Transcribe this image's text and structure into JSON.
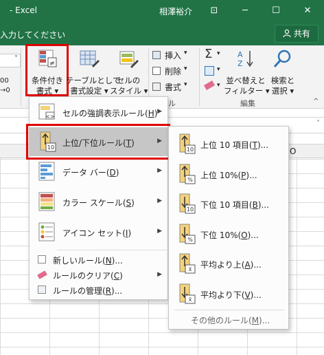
{
  "titlebar": {
    "app": "- Excel",
    "user": "相澤裕介",
    "restore_glyph": "⊡",
    "min_glyph": "─",
    "max_glyph": "☐",
    "close_glyph": "✕"
  },
  "tellme": {
    "text": "入力してください",
    "share_label": "共有",
    "share_icon": "person-icon"
  },
  "ribbon": {
    "font_box_chevron": "˅",
    "cf_button": {
      "line1": "条件付き",
      "line2": "書式 ▾"
    },
    "table_button": {
      "line1": "テーブルとして",
      "line2": "書式設定 ▾"
    },
    "style_button": {
      "line1": "セルの",
      "line2": "スタイル ▾"
    },
    "insert": "挿入",
    "delete": "削除",
    "format": "書式",
    "sort": {
      "line1": "並べ替えと",
      "line2": "フィルター ▾"
    },
    "find": {
      "line1": "検索と",
      "line2": "選択 ▾"
    },
    "group_cells": "セル",
    "group_edit": "編集",
    "num_fmt_left": "00",
    "num_fmt_right": "→0"
  },
  "column_label": "O",
  "cf_menu": {
    "items": [
      {
        "label": "セルの強調表示ルール(",
        "key": "H",
        "tail": ")"
      },
      {
        "label": "上位/下位ルール(",
        "key": "T",
        "tail": ")"
      },
      {
        "label": "データ バー(",
        "key": "D",
        "tail": ")"
      },
      {
        "label": "カラー スケール(",
        "key": "S",
        "tail": ")"
      },
      {
        "label": "アイコン セット(",
        "key": "I",
        "tail": ")"
      }
    ],
    "small_items": [
      {
        "label": "新しいルール(",
        "key": "N",
        "tail": ")..."
      },
      {
        "label": "ルールのクリア(",
        "key": "C",
        "tail": ")"
      },
      {
        "label": "ルールの管理(",
        "key": "R",
        "tail": ")..."
      }
    ]
  },
  "sub_menu": {
    "items": [
      {
        "label": "上位 10 項目(",
        "key": "T",
        "tail": ")...",
        "badge": "10"
      },
      {
        "label": "上位 10%(",
        "key": "P",
        "tail": ")...",
        "badge": "%"
      },
      {
        "label": "下位 10 項目(",
        "key": "B",
        "tail": ")...",
        "badge": "10"
      },
      {
        "label": "下位 10%(",
        "key": "O",
        "tail": ")...",
        "badge": "%"
      },
      {
        "label": "平均より上(",
        "key": "A",
        "tail": ")...",
        "badge": "x̄"
      },
      {
        "label": "平均より下(",
        "key": "V",
        "tail": ")...",
        "badge": "x̄"
      }
    ],
    "more": {
      "label": "その他のルール(",
      "key": "M",
      "tail": ")..."
    }
  },
  "colors": {
    "excel_green": "#217346",
    "highlight_red": "#e00000",
    "menu_hover": "#c6c6c6"
  }
}
